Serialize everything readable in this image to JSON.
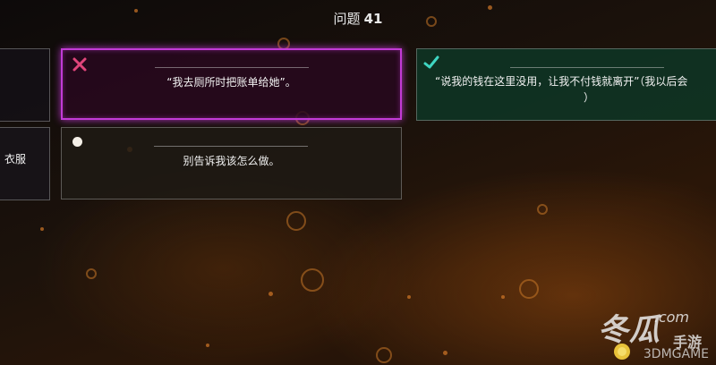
{
  "header": {
    "title_label": "问题",
    "question_number": "41"
  },
  "options": {
    "left_partial_1": {
      "text": ""
    },
    "left_partial_2": {
      "text": "衣服"
    },
    "option_a": {
      "text": "“我去厕所时把账单给她”。",
      "status": "wrong",
      "icon": "cross-icon",
      "border_color": "#c23bd6",
      "icon_color": "#e0457b"
    },
    "option_b": {
      "text": "别告诉我该怎么做。",
      "status": "unselected",
      "icon": "dot-icon"
    },
    "option_c": {
      "text": "“说我的钱在这里没用，让我不付钱就离开”（我以后会",
      "text_line2": "）",
      "status": "correct",
      "icon": "check-icon",
      "icon_color": "#3fd6c2"
    }
  },
  "watermark": {
    "brand_big": "冬瓜",
    "brand_small": "手游",
    "domain_suffix": ".com",
    "sub_text": "3DMGAME"
  }
}
